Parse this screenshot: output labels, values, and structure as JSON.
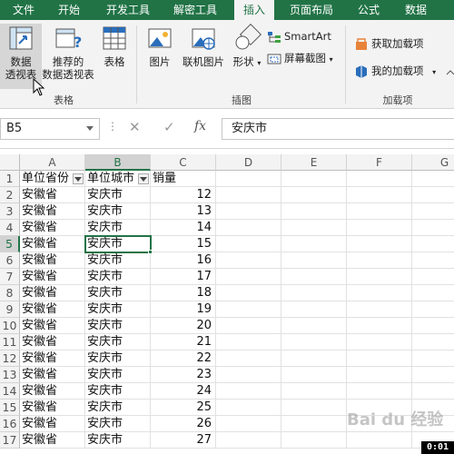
{
  "tabs": [
    {
      "label": "文件",
      "active": false
    },
    {
      "label": "开始",
      "active": false
    },
    {
      "label": "开发工具",
      "active": false
    },
    {
      "label": "解密工具",
      "active": false
    },
    {
      "label": "插入",
      "active": true
    },
    {
      "label": "页面布局",
      "active": false
    },
    {
      "label": "公式",
      "active": false
    },
    {
      "label": "数据",
      "active": false
    }
  ],
  "ribbon": {
    "pivot_table_line1": "数据",
    "pivot_table_line2": "透视表",
    "recommended_pivot_line1": "推荐的",
    "recommended_pivot_line2": "数据透视表",
    "table_label": "表格",
    "group_tables": "表格",
    "pictures_label": "图片",
    "online_pictures_label": "联机图片",
    "shapes_label": "形状",
    "smartart_label": "SmartArt",
    "screenshot_label": "屏幕截图",
    "group_illustrations": "插图",
    "get_addins_label": "获取加载项",
    "my_addins_label": "我的加载项",
    "group_addins": "加载项"
  },
  "formula_bar": {
    "name_box": "B5",
    "cancel_icon": "✕",
    "enter_icon": "✓",
    "fx_label": "fx",
    "value": "安庆市"
  },
  "sheet": {
    "columns": [
      "A",
      "B",
      "C",
      "D",
      "E",
      "F",
      "G"
    ],
    "headers": [
      "单位省份",
      "单位城市",
      "销量"
    ],
    "rows": [
      {
        "n": "1"
      },
      {
        "n": "2",
        "a": "安徽省",
        "b": "安庆市",
        "c": "12"
      },
      {
        "n": "3",
        "a": "安徽省",
        "b": "安庆市",
        "c": "13"
      },
      {
        "n": "4",
        "a": "安徽省",
        "b": "安庆市",
        "c": "14"
      },
      {
        "n": "5",
        "a": "安徽省",
        "b": "安庆市",
        "c": "15"
      },
      {
        "n": "6",
        "a": "安徽省",
        "b": "安庆市",
        "c": "16"
      },
      {
        "n": "7",
        "a": "安徽省",
        "b": "安庆市",
        "c": "17"
      },
      {
        "n": "8",
        "a": "安徽省",
        "b": "安庆市",
        "c": "18"
      },
      {
        "n": "9",
        "a": "安徽省",
        "b": "安庆市",
        "c": "19"
      },
      {
        "n": "10",
        "a": "安徽省",
        "b": "安庆市",
        "c": "20"
      },
      {
        "n": "11",
        "a": "安徽省",
        "b": "安庆市",
        "c": "21"
      },
      {
        "n": "12",
        "a": "安徽省",
        "b": "安庆市",
        "c": "22"
      },
      {
        "n": "13",
        "a": "安徽省",
        "b": "安庆市",
        "c": "23"
      },
      {
        "n": "14",
        "a": "安徽省",
        "b": "安庆市",
        "c": "24"
      },
      {
        "n": "15",
        "a": "安徽省",
        "b": "安庆市",
        "c": "25"
      },
      {
        "n": "16",
        "a": "安徽省",
        "b": "安庆市",
        "c": "26"
      },
      {
        "n": "17",
        "a": "安徽省",
        "b": "安庆市",
        "c": "27"
      }
    ],
    "active_row": "5",
    "active_col": "B"
  },
  "overlay": {
    "timer": "0:01",
    "watermark": "Bai du 经验"
  },
  "colors": {
    "accent": "#217346",
    "ribbon_bg": "#f3f3f3"
  }
}
